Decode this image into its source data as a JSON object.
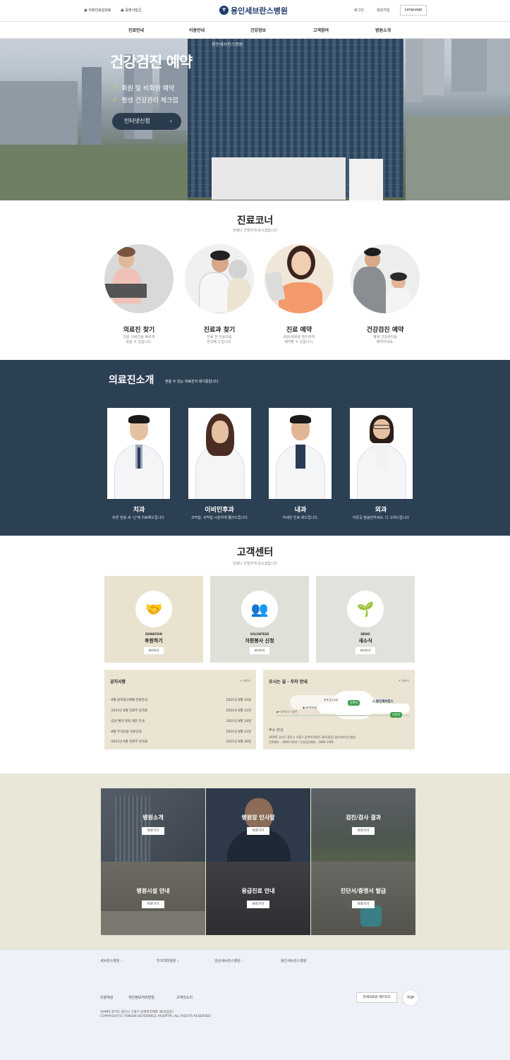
{
  "header": {
    "util_left": [
      "외래진료일정표",
      "증명서발급"
    ],
    "logo_text": "용인세브란스병원",
    "util_right": [
      "로그인",
      "회원가입"
    ],
    "language_label": "Language"
  },
  "nav": [
    "진료안내",
    "이용안내",
    "건강정보",
    "고객참여",
    "병원소개"
  ],
  "hero": {
    "building_sign": "용인세브란스병원",
    "title": "건강검진 예약",
    "bullets": [
      "회원 및 비회원 예약",
      "평생 건강관리 체크업"
    ],
    "button_label": "인터넷신청",
    "button_arrow": "›"
  },
  "care_corner": {
    "title": "진료코너",
    "subtitle": "언제나 친절하게 모시겠습니다",
    "items": [
      {
        "name": "의료진 찾기",
        "desc": [
          "전문 의료진을 빠르게",
          "찾을 수 있습니다."
        ]
      },
      {
        "name": "진료과 찾기",
        "desc": [
          "진료 전 진료과를",
          "안내해 드립니다."
        ]
      },
      {
        "name": "진료 예약",
        "desc": [
          "회원/비회원 편리하게",
          "예약할 수 있습니다."
        ]
      },
      {
        "name": "건강검진 예약",
        "desc": [
          "평생 건강관리를",
          "예약하세요."
        ]
      }
    ]
  },
  "doctors": {
    "title": "의료진소개",
    "subtitle": "믿을 수 있는 의료진이 대기중입니다.",
    "items": [
      {
        "dept": "치과",
        "desc": "바른 믿음 세 '닌'에 치료해드립니다"
      },
      {
        "dept": "이비인후과",
        "desc": "코막힘, 귀막힘 시원하게 뚫어드립니다"
      },
      {
        "dept": "내과",
        "desc": "자세한 진료 봐드립니다."
      },
      {
        "dept": "외과",
        "desc": "아픈곳 말씀만하세요. 다 고쳐드립니다"
      }
    ]
  },
  "customer_center": {
    "title": "고객센터",
    "subtitle": "언제나 친절하게 모시겠습니다",
    "cards": [
      {
        "en": "DONATION",
        "ko": "후원하기",
        "button": "보러가기",
        "icon": "handshake-icon",
        "bg": "#e8e2cf"
      },
      {
        "en": "VOLUNTEER",
        "ko": "자원봉사 신청",
        "button": "보러가기",
        "icon": "volunteer-icon",
        "bg": "#e0e0d9"
      },
      {
        "en": "NEWS",
        "ko": "새소식",
        "button": "보러가기",
        "icon": "sprout-icon",
        "bg": "#e0e3dc"
      }
    ],
    "notice": {
      "title": "공지사항",
      "more": "+ 더보기",
      "rows": [
        {
          "text": "-8월 원목정규예배 진료안내",
          "date": "2021년 8월 10일"
        },
        {
          "text": "-2021년 8월 진료부 담직표",
          "date": "2021년 8월 12일"
        },
        {
          "text": "-입원 환자 면회 제한 안내",
          "date": "2021년 8월 18일"
        },
        {
          "text": "-8월 주식만큼 진료안내",
          "date": "2021년 8월 23일"
        },
        {
          "text": "-2021년 9월 진료부 담직표",
          "date": "2021년 8월 28일"
        }
      ]
    },
    "directions": {
      "title": "오시는 길 · 주차 안내",
      "more": "+ 더보기",
      "map_labels": [
        "용인세브란스",
        "동백역",
        "어정역",
        "동백 호수공원",
        "동백터미널",
        "동백지구 방면"
      ],
      "address_title": "주소 안내",
      "address": "16995 경기도 용인시 기흥구 동백죽전대로 363(중동) 용인세브란스병원",
      "phones": "진료예약 : 1899-1004 / 건강검진예약 : 1899-1565"
    }
  },
  "links": [
    {
      "title": "병원소개",
      "button": "바로가기"
    },
    {
      "title": "병원장 인사말",
      "button": "바로가기"
    },
    {
      "title": "검진/검사 결과",
      "button": "바로가기"
    },
    {
      "title": "병원시설 안내",
      "button": "바로가기"
    },
    {
      "title": "응급진료 안내",
      "button": "바로가기"
    },
    {
      "title": "진단서/증명서 발급",
      "button": "바로가기"
    }
  ],
  "family_sites": [
    "세브란스병원",
    "치과대학병원",
    "강남세브란스병원",
    "용인세브란스병원"
  ],
  "footer": {
    "links": [
      "이용약관",
      "개인정보처리방침",
      "고객의소리"
    ],
    "address": "16995 경기도 용인시 기흥구 동백죽전대로 363(중동)",
    "copyright": "COPYRIGHT(C) YONGIN SEVERANCE HOSPITAL ALL RIGHTS RESERVED",
    "network_button": "연세의료원 네트워크",
    "top_button": "TOP"
  }
}
